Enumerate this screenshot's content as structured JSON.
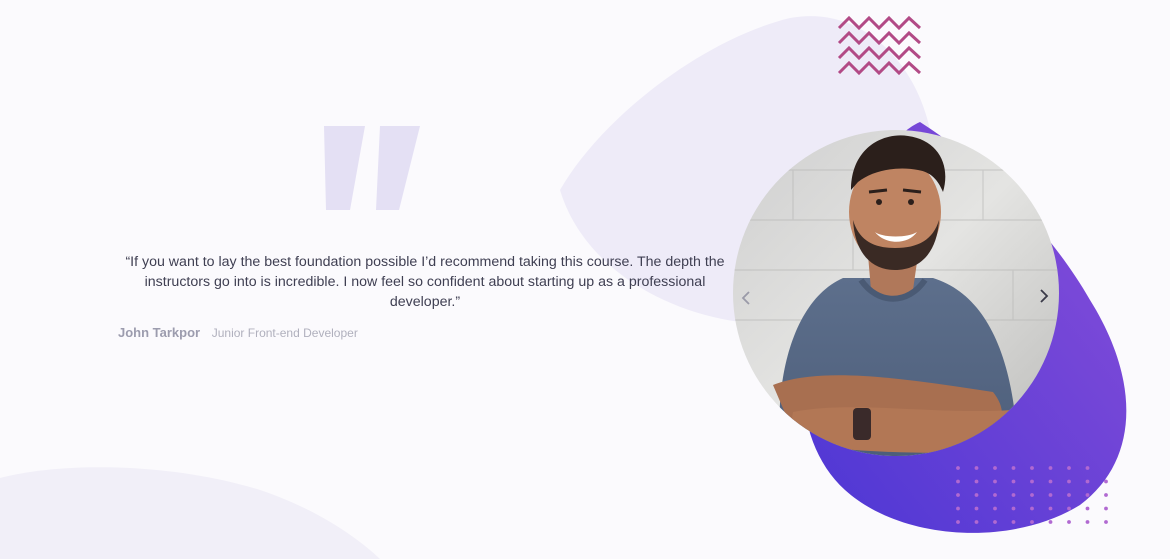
{
  "testimonial": {
    "quote": "“If you want to lay the best foundation possible I’d recommend taking this course. The depth the instructors go into is incredible. I now feel so confident about starting up as a professional developer.”",
    "author_name": "John Tarkpor",
    "author_role": "Junior Front-end Developer"
  },
  "icons": {
    "quote": "quote-icon",
    "prev": "chevron-left-icon",
    "next": "chevron-right-icon",
    "zigzag": "zigzag-decoration",
    "dots": "dot-grid-decoration"
  },
  "colors": {
    "background": "#fbfafd",
    "blob_light": "#eeebf8",
    "gradient_start": "#4c36d4",
    "gradient_end": "#8a4fd9",
    "zigzag": "#b24a86",
    "dots": "#b169d1",
    "quote_mark": "#e4e0f4"
  }
}
